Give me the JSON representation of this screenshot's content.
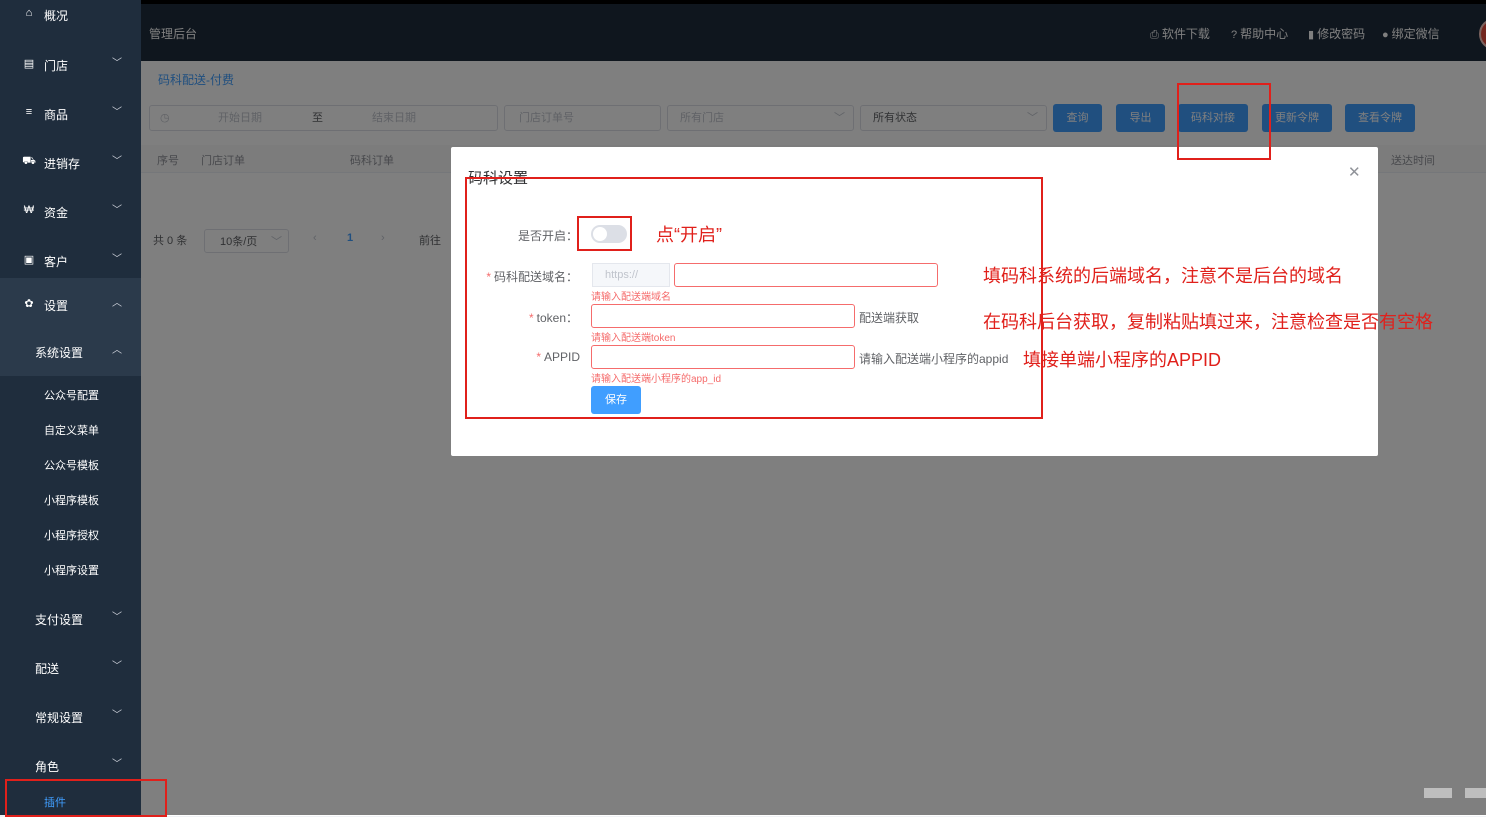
{
  "sidebar": {
    "items": [
      {
        "icon": "home-icon",
        "glyph": "⌂",
        "label": "概况"
      },
      {
        "icon": "store-icon",
        "glyph": "▤",
        "label": "门店"
      },
      {
        "icon": "list-icon",
        "glyph": "≡",
        "label": "商品"
      },
      {
        "icon": "truck-icon",
        "glyph": "⛟",
        "label": "进销存"
      },
      {
        "icon": "won-icon",
        "glyph": "₩",
        "label": "资金"
      },
      {
        "icon": "id-card-icon",
        "glyph": "▣",
        "label": "客户"
      },
      {
        "icon": "gear-icon",
        "glyph": "✿",
        "label": "设置"
      }
    ],
    "system_settings": "系统设置",
    "leaves": [
      "公众号配置",
      "自定义菜单",
      "公众号模板",
      "小程序模板",
      "小程序授权",
      "小程序设置"
    ],
    "groups": [
      "支付设置",
      "配送",
      "常规设置",
      "角色"
    ],
    "plugin": "插件"
  },
  "header": {
    "title": "管理后台",
    "links": [
      {
        "icon": "printer-icon",
        "glyph": "⎙",
        "label": "软件下载"
      },
      {
        "icon": "help-icon",
        "glyph": "?",
        "label": "帮助中心"
      },
      {
        "icon": "thermometer-icon",
        "glyph": "▮",
        "label": "修改密码"
      },
      {
        "icon": "wechat-icon",
        "glyph": "●",
        "label": "绑定微信"
      }
    ]
  },
  "page": {
    "title": "码科配送-付费",
    "filters": {
      "start_date": "开始日期",
      "to": "至",
      "end_date": "结束日期",
      "store_order_no": "门店订单号",
      "all_stores": "所有门店",
      "all_status": "所有状态"
    },
    "buttons": [
      "查询",
      "导出",
      "码科对接",
      "更新令牌",
      "查看令牌"
    ],
    "columns": [
      "序号",
      "门店订单",
      "码科订单",
      "送达时间"
    ],
    "pager": {
      "total": "共 0 条",
      "page_size": "10条/页",
      "current": "1",
      "goto": "前往"
    }
  },
  "dialog": {
    "title": "码科设置",
    "fields": {
      "enable_label": "是否开启：",
      "domain_label": "码科配送域名：",
      "domain_prefix": "https://",
      "domain_error": "请输入配送端域名",
      "token_label": "token：",
      "token_hint": "配送端获取",
      "token_error": "请输入配送端token",
      "appid_label": "APPID",
      "appid_hint": "请输入配送端小程序的appid",
      "appid_error": "请输入配送端小程序的app_id"
    },
    "save": "保存"
  },
  "annotations": {
    "click_enable": "点“开启”",
    "domain_note": "填码科系统的后端域名，注意不是后台的域名",
    "token_note": "在码科后台获取，复制粘贴填过来，注意检查是否有空格",
    "appid_note": "填接单端小程序的APPID",
    "color": "#e0201b"
  }
}
